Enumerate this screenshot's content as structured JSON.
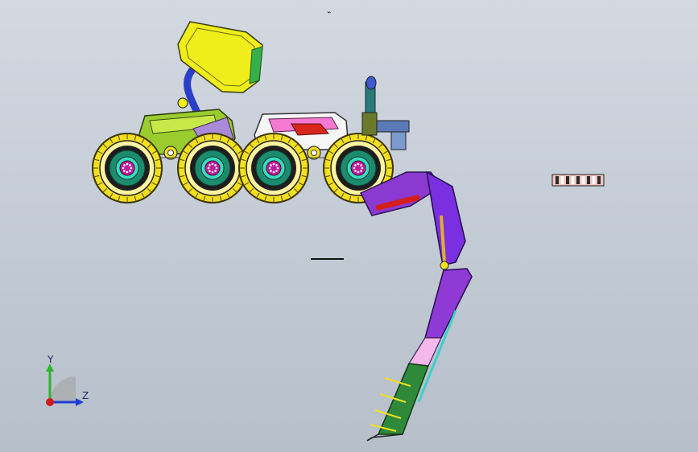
{
  "viewport": {
    "background_top": "#d3d9e1",
    "background_bottom": "#b6bfca"
  },
  "triad": {
    "y_label": "Y",
    "z_label": "Z",
    "y_color": "#2bb52b",
    "z_color": "#1f3fd6",
    "origin_color": "#d11a1a"
  },
  "cursor_glyph": "⌁",
  "model": {
    "icon": "vehicle-with-crane-arm",
    "wheel_tire_color": "#f2e020",
    "wheel_rim_color": "#1c8c6e",
    "wheel_hub_color": "#c21c9e",
    "body_front_color": "#9acc2e",
    "body_rear_color": "#f27ad0",
    "sensor_head_color": "#f0ee1a",
    "arm_color": "#7a2fe0",
    "arm_segment_color": "#8f3ad6",
    "arm_green_color": "#2e8a3a",
    "arm_pink_color": "#f4b8ea",
    "hydraulic_color": "#d41d1d"
  }
}
